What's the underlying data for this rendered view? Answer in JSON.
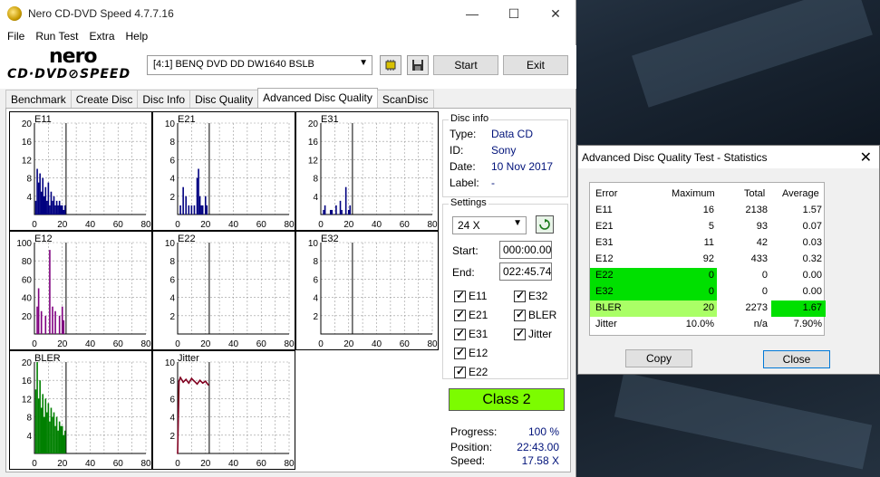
{
  "window": {
    "title": "Nero CD-DVD Speed 4.7.7.16",
    "minimize": "—",
    "maximize": "☐",
    "close": "✕"
  },
  "menu": [
    "File",
    "Run Test",
    "Extra",
    "Help"
  ],
  "logo": {
    "line1": "nero",
    "line2": "CD·DVD⊘SPEED"
  },
  "toolbar": {
    "drive": "[4:1]   BENQ DVD DD DW1640 BSLB",
    "start_label": "Start",
    "exit_label": "Exit",
    "chip_icon": "chip-icon",
    "save_icon": "save-icon"
  },
  "tabs": [
    "Benchmark",
    "Create Disc",
    "Disc Info",
    "Disc Quality",
    "Advanced Disc Quality",
    "ScanDisc"
  ],
  "active_tab": 4,
  "disc_info": {
    "title": "Disc info",
    "type_label": "Type:",
    "type": "Data CD",
    "id_label": "ID:",
    "id": "Sony",
    "date_label": "Date:",
    "date": "10 Nov 2017",
    "label_label": "Label:",
    "label": "-"
  },
  "settings": {
    "title": "Settings",
    "speed": "24 X",
    "start_label": "Start:",
    "start": "000:00.00",
    "end_label": "End:",
    "end": "022:45.74",
    "checkboxes": [
      "E11",
      "E32",
      "E21",
      "BLER",
      "E31",
      "Jitter",
      "E12",
      "E22"
    ]
  },
  "result": {
    "class": "Class 2"
  },
  "progress": {
    "progress_label": "Progress:",
    "progress": "100 %",
    "position_label": "Position:",
    "position": "22:43.00",
    "speed_label": "Speed:",
    "speed": "17.58 X"
  },
  "colors": {
    "error_blue": "#000080",
    "error_purple": "#800080",
    "bler_green": "#008000",
    "jitter_red": "#800020",
    "class_green": "#7cfc00",
    "highlight_green": "#00e000",
    "highlight_light": "#aaff66"
  },
  "chart_data": [
    {
      "type": "bar",
      "title": "E11",
      "ylim": [
        0,
        20
      ],
      "yticks": [
        "20",
        "16",
        "12",
        "8",
        "4"
      ],
      "xlim": [
        0,
        80
      ],
      "xticks": [
        "0",
        "20",
        "40",
        "60",
        "80"
      ],
      "marker_x": 22.7,
      "x": [
        1,
        2,
        3,
        4,
        5,
        6,
        7,
        8,
        9,
        10,
        11,
        12,
        13,
        14,
        15,
        16,
        17,
        18,
        19,
        20,
        21,
        22
      ],
      "values": [
        3,
        10,
        7,
        9,
        5,
        8,
        4,
        6,
        3,
        7,
        2,
        5,
        3,
        4,
        2,
        3,
        2,
        3,
        2,
        2,
        1,
        2
      ]
    },
    {
      "type": "bar",
      "title": "E21",
      "ylim": [
        0,
        10
      ],
      "yticks": [
        "10",
        "8",
        "6",
        "4",
        "2"
      ],
      "xlim": [
        0,
        80
      ],
      "xticks": [
        "0",
        "20",
        "40",
        "60",
        "80"
      ],
      "marker_x": 22.7,
      "x": [
        2,
        4,
        6,
        8,
        10,
        12,
        14,
        15,
        16,
        17,
        18,
        20,
        21
      ],
      "values": [
        1,
        3,
        2,
        1,
        1,
        1,
        4,
        5,
        2,
        1,
        1,
        2,
        1
      ]
    },
    {
      "type": "bar",
      "title": "E31",
      "ylim": [
        0,
        20
      ],
      "yticks": [
        "20",
        "16",
        "12",
        "8",
        "4"
      ],
      "xlim": [
        0,
        80
      ],
      "xticks": [
        "0",
        "20",
        "40",
        "60",
        "80"
      ],
      "marker_x": 22.7,
      "x": [
        2,
        3,
        7,
        8,
        11,
        14,
        15,
        18,
        20,
        21
      ],
      "values": [
        1,
        2,
        1,
        1,
        2,
        3,
        1,
        6,
        1,
        2
      ]
    },
    {
      "type": "bar",
      "title": "E12",
      "ylim": [
        0,
        100
      ],
      "yticks": [
        "100",
        "80",
        "60",
        "40",
        "20"
      ],
      "xlim": [
        0,
        80
      ],
      "xticks": [
        "0",
        "20",
        "40",
        "60",
        "80"
      ],
      "marker_x": 22.7,
      "x": [
        2,
        3,
        5,
        8,
        11,
        13,
        15,
        18,
        20,
        21
      ],
      "values": [
        30,
        50,
        25,
        20,
        92,
        30,
        25,
        20,
        30,
        15
      ]
    },
    {
      "type": "bar",
      "title": "E22",
      "ylim": [
        0,
        10
      ],
      "yticks": [
        "10",
        "8",
        "6",
        "4",
        "2"
      ],
      "xlim": [
        0,
        80
      ],
      "xticks": [
        "0",
        "20",
        "40",
        "60",
        "80"
      ],
      "marker_x": 22.7,
      "x": [],
      "values": []
    },
    {
      "type": "bar",
      "title": "E32",
      "ylim": [
        0,
        10
      ],
      "yticks": [
        "10",
        "8",
        "6",
        "4",
        "2"
      ],
      "xlim": [
        0,
        80
      ],
      "xticks": [
        "0",
        "20",
        "40",
        "60",
        "80"
      ],
      "marker_x": 22.7,
      "x": [],
      "values": []
    },
    {
      "type": "bar",
      "title": "BLER",
      "ylim": [
        0,
        20
      ],
      "yticks": [
        "20",
        "16",
        "12",
        "8",
        "4"
      ],
      "xlim": [
        0,
        80
      ],
      "xticks": [
        "0",
        "20",
        "40",
        "60",
        "80"
      ],
      "marker_x": 22.7,
      "x": [
        1,
        2,
        3,
        4,
        5,
        6,
        7,
        8,
        9,
        10,
        11,
        12,
        13,
        14,
        15,
        16,
        17,
        18,
        19,
        20,
        21,
        22
      ],
      "values": [
        14,
        20,
        12,
        16,
        10,
        13,
        8,
        12,
        9,
        11,
        7,
        10,
        8,
        9,
        6,
        8,
        5,
        7,
        6,
        6,
        4,
        5
      ]
    },
    {
      "type": "line",
      "title": "Jitter",
      "ylim": [
        0,
        10
      ],
      "yticks": [
        "10",
        "8",
        "6",
        "4",
        "2"
      ],
      "xlim": [
        0,
        80
      ],
      "xticks": [
        "0",
        "20",
        "40",
        "60",
        "80"
      ],
      "marker_x": 22.7,
      "x": [
        0,
        1,
        2,
        4,
        6,
        8,
        10,
        12,
        14,
        16,
        18,
        20,
        22
      ],
      "values": [
        0,
        7.9,
        8.3,
        7.8,
        8.1,
        7.7,
        8.2,
        7.9,
        7.6,
        8.0,
        7.7,
        7.9,
        7.5
      ]
    }
  ],
  "stats": {
    "title": "Advanced Disc Quality Test - Statistics",
    "close_icon": "✕",
    "headers": [
      "Error",
      "Maximum",
      "Total",
      "Average"
    ],
    "rows": [
      {
        "error": "E11",
        "maximum": "16",
        "total": "2138",
        "average": "1.57",
        "hl": ""
      },
      {
        "error": "E21",
        "maximum": "5",
        "total": "93",
        "average": "0.07",
        "hl": ""
      },
      {
        "error": "E31",
        "maximum": "11",
        "total": "42",
        "average": "0.03",
        "hl": ""
      },
      {
        "error": "E12",
        "maximum": "92",
        "total": "433",
        "average": "0.32",
        "hl": ""
      },
      {
        "error": "E22",
        "maximum": "0",
        "total": "0",
        "average": "0.00",
        "hl": "green"
      },
      {
        "error": "E32",
        "maximum": "0",
        "total": "0",
        "average": "0.00",
        "hl": "green"
      },
      {
        "error": "BLER",
        "maximum": "20",
        "total": "2273",
        "average": "1.67",
        "hl": "bler"
      },
      {
        "error": "Jitter",
        "maximum": "10.0%",
        "total": "n/a",
        "average": "7.90%",
        "hl": ""
      }
    ],
    "copy_label": "Copy",
    "close_label": "Close"
  }
}
